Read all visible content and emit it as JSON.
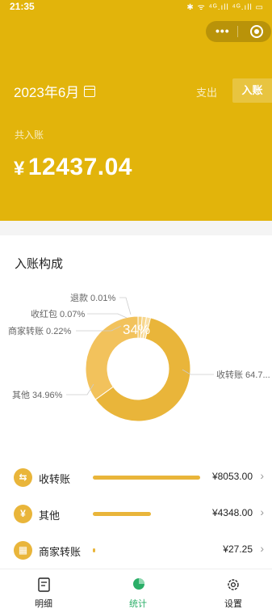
{
  "status": {
    "time": "21:35",
    "icons": "✱ ᯤ ⁴ᴳ.ıll ⁴ᴳ.ıll ▭"
  },
  "capsule": {
    "more": "•••"
  },
  "header": {
    "month": "2023年6月",
    "tab_expense": "支出",
    "tab_income": "入账",
    "total_label": "共入账",
    "currency": "¥",
    "total_amount": "12437.04",
    "bg_color": "#e2b40b"
  },
  "composition": {
    "title": "入账构成",
    "center_label": "34%",
    "labels": [
      {
        "text": "退款 0.01%"
      },
      {
        "text": "收红包 0.07%"
      },
      {
        "text": "商家转账 0.22%"
      },
      {
        "text": "其他 34.96%"
      },
      {
        "text": "收转账 64.7..."
      }
    ]
  },
  "chart_data": {
    "type": "pie",
    "title": "入账构成",
    "slices": [
      {
        "label": "收转账",
        "value": 64.74,
        "color": "#e9b53a"
      },
      {
        "label": "其他",
        "value": 34.96,
        "color": "#f2c25c"
      },
      {
        "label": "商家转账",
        "value": 0.22,
        "color": "#f5ce78"
      },
      {
        "label": "收红包",
        "value": 0.07,
        "color": "#f7d68c"
      },
      {
        "label": "退款",
        "value": 0.01,
        "color": "#f9dea2"
      }
    ]
  },
  "list": [
    {
      "name": "收转账",
      "amount": "¥8053.00",
      "icon": "transfer-icon",
      "icon_glyph": "⇆",
      "ratio": 1.0
    },
    {
      "name": "其他",
      "amount": "¥4348.00",
      "icon": "yen-icon",
      "icon_glyph": "¥",
      "ratio": 0.54
    },
    {
      "name": "商家转账",
      "amount": "¥27.25",
      "icon": "shop-icon",
      "icon_glyph": "▦",
      "ratio": 0.02
    }
  ],
  "tabbar": [
    {
      "label": "明细",
      "icon": "document-icon",
      "active": false
    },
    {
      "label": "统计",
      "icon": "pie-chart-icon",
      "active": true
    },
    {
      "label": "设置",
      "icon": "gear-icon",
      "active": false
    }
  ],
  "colors": {
    "accent": "#e2b40b",
    "bar": "#e9b53a",
    "active_tab": "#2aae67"
  }
}
